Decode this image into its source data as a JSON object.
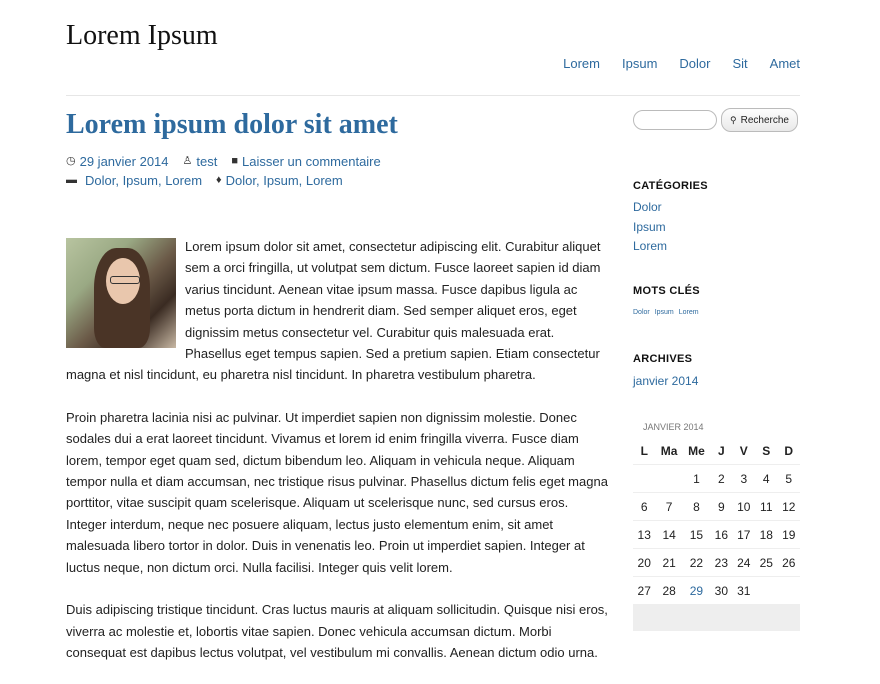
{
  "site": {
    "title": "Lorem Ipsum"
  },
  "nav": [
    "Lorem",
    "Ipsum",
    "Dolor",
    "Sit",
    "Amet"
  ],
  "post": {
    "title": "Lorem ipsum dolor sit amet",
    "date": "29 janvier 2014",
    "author": "test",
    "comment_link": "Laisser un commentaire",
    "categories": "Dolor, Ipsum, Lorem",
    "tags": "Dolor, Ipsum, Lorem",
    "paragraphs": [
      "Lorem ipsum dolor sit amet, consectetur adipiscing elit. Curabitur aliquet sem a orci fringilla, ut volutpat sem dictum. Fusce laoreet sapien id diam varius tincidunt. Aenean vitae ipsum massa. Fusce dapibus ligula ac metus porta dictum in hendrerit diam. Sed semper aliquet eros, eget dignissim metus consectetur vel. Curabitur quis malesuada erat. Phasellus eget tempus sapien. Sed a pretium sapien. Etiam consectetur magna et nisl tincidunt, eu pharetra nisl tincidunt. In pharetra vestibulum pharetra.",
      "Proin pharetra lacinia nisi ac pulvinar. Ut imperdiet sapien non dignissim molestie. Donec sodales dui a erat laoreet tincidunt. Vivamus et lorem id enim fringilla viverra. Fusce diam lorem, tempor eget quam sed, dictum bibendum leo. Aliquam in vehicula neque. Aliquam tempor nulla et diam accumsan, nec tristique risus pulvinar. Phasellus dictum felis eget magna porttitor, vitae suscipit quam scelerisque. Aliquam ut scelerisque nunc, sed cursus eros. Integer interdum, neque nec posuere aliquam, lectus justo elementum enim, sit amet malesuada libero tortor in dolor. Duis in venenatis leo. Proin ut imperdiet sapien. Integer at luctus neque, non dictum orci. Nulla facilisi. Integer quis velit lorem.",
      "Duis adipiscing tristique tincidunt. Cras luctus mauris at aliquam sollicitudin. Quisque nisi eros, viverra ac molestie et, lobortis vitae sapien. Donec vehicula accumsan dictum. Morbi consequat est dapibus lectus volutpat, vel vestibulum mi convallis. Aenean dictum odio urna."
    ]
  },
  "sidebar": {
    "search_button": "Recherche",
    "categories_title": "CATÉGORIES",
    "categories": [
      "Dolor",
      "Ipsum",
      "Lorem"
    ],
    "tags_title": "MOTS CLÉS",
    "tags": [
      "Dolor",
      "Ipsum",
      "Lorem"
    ],
    "archives_title": "ARCHIVES",
    "archives": [
      "janvier 2014"
    ]
  },
  "calendar": {
    "caption": "JANVIER 2014",
    "days": [
      "L",
      "Ma",
      "Me",
      "J",
      "V",
      "S",
      "D"
    ],
    "weeks": [
      [
        "",
        "",
        "1",
        "2",
        "3",
        "4",
        "5"
      ],
      [
        "6",
        "7",
        "8",
        "9",
        "10",
        "11",
        "12"
      ],
      [
        "13",
        "14",
        "15",
        "16",
        "17",
        "18",
        "19"
      ],
      [
        "20",
        "21",
        "22",
        "23",
        "24",
        "25",
        "26"
      ],
      [
        "27",
        "28",
        "29",
        "30",
        "31",
        "",
        ""
      ]
    ],
    "today": "29"
  },
  "colors": {
    "link": "#2e6a9e",
    "text": "#222222"
  }
}
